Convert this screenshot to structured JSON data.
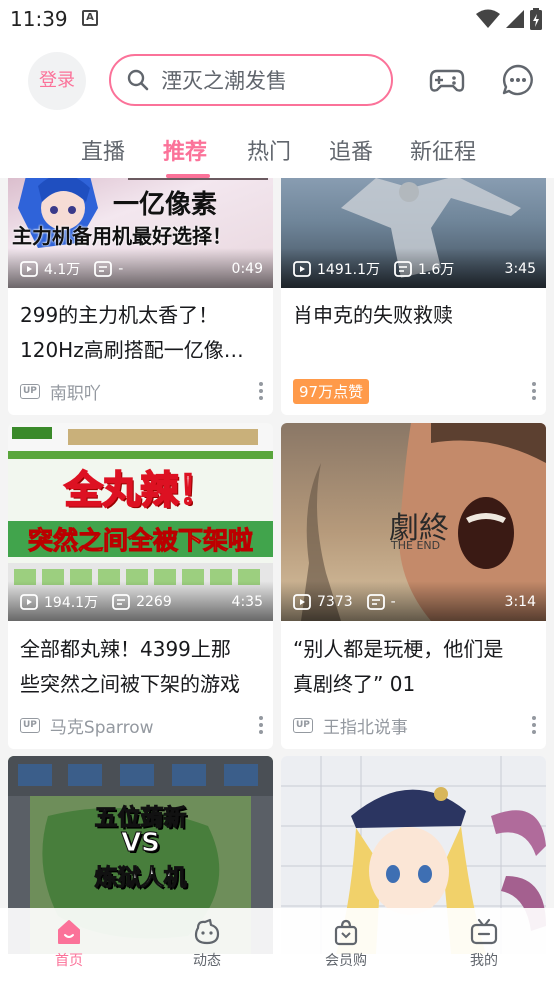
{
  "status": {
    "time": "11:39",
    "notif_letter": "A"
  },
  "header": {
    "login_label": "登录",
    "search_text": "湮灭之潮发售",
    "icons": [
      "gamepad-icon",
      "chat-icon"
    ]
  },
  "tabs": [
    {
      "label": "直播",
      "active": false
    },
    {
      "label": "推荐",
      "active": true
    },
    {
      "label": "热门",
      "active": false
    },
    {
      "label": "追番",
      "active": false
    },
    {
      "label": "新征程",
      "active": false
    }
  ],
  "cards": [
    {
      "thumb_text_top": "一亿像素",
      "thumb_text_bottom": "主力机备用机最好选择！",
      "plays": "4.1万",
      "comments": "-",
      "duration": "0:49",
      "title_line1": "299的主力机太香了！",
      "title_line2": "120Hz高刷搭配一亿像…",
      "uploader": "南职吖"
    },
    {
      "plays": "1491.1万",
      "comments": "1.6万",
      "duration": "3:45",
      "title_line1": "肖申克的失败救赎",
      "like_badge": "97万点赞"
    },
    {
      "thumb_text_top": "全丸辣！",
      "thumb_text_bottom": "突然之间全被下架啦",
      "plays": "194.1万",
      "comments": "2269",
      "duration": "4:35",
      "title_line1": "全部都丸辣！4399上那",
      "title_line2": "些突然之间被下架的游戏",
      "uploader": "马克Sparrow"
    },
    {
      "thumb_text_top": "劇終",
      "thumb_text_bottom": "THE END",
      "plays": "7373",
      "comments": "-",
      "duration": "3:14",
      "title_line1": "“别人都是玩梗，他们是",
      "title_line2": "真剧终了” 01",
      "uploader": "王指北说事"
    },
    {
      "thumb_text_top": "五位蒟新",
      "thumb_text_mid": "VS",
      "thumb_text_bottom": "炼狱人机"
    },
    {}
  ],
  "bottom_nav": [
    {
      "label": "首页",
      "icon": "home-icon",
      "active": true
    },
    {
      "label": "动态",
      "icon": "dynamic-icon",
      "active": false
    },
    {
      "label": "会员购",
      "icon": "shopping-bag-icon",
      "active": false
    },
    {
      "label": "我的",
      "icon": "tv-icon",
      "active": false
    }
  ],
  "colors": {
    "accent": "#fb7299",
    "badge_orange": "#ff9a4a",
    "text_gray": "#9499a0"
  }
}
